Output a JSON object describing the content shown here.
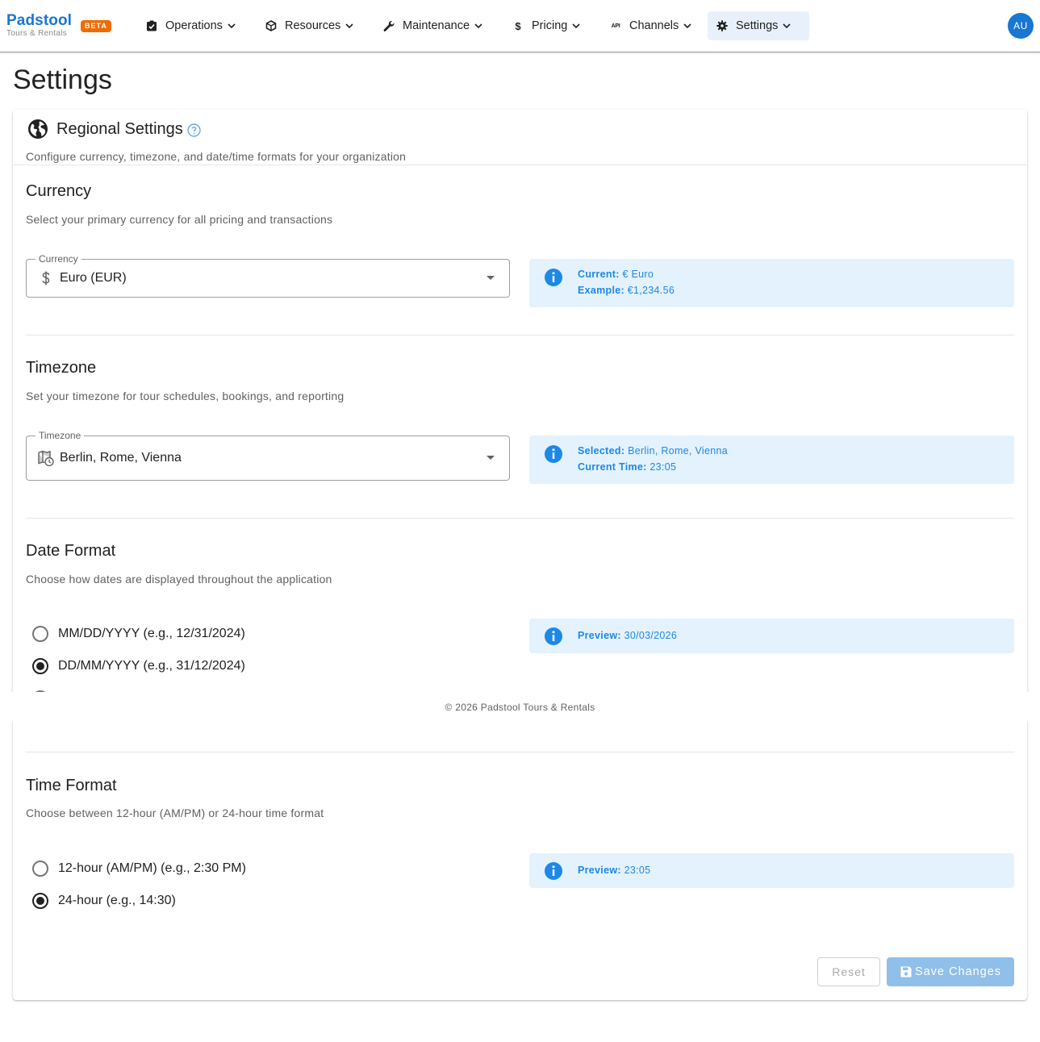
{
  "brand": {
    "name": "Padstool",
    "subtitle": "Tours & Rentals",
    "badge": "BETA"
  },
  "nav": [
    {
      "label": "Operations",
      "icon": "clipboard-icon"
    },
    {
      "label": "Resources",
      "icon": "cube-icon"
    },
    {
      "label": "Maintenance",
      "icon": "wrench-icon"
    },
    {
      "label": "Pricing",
      "icon": "dollar-icon"
    },
    {
      "label": "Channels",
      "icon": "api-icon"
    },
    {
      "label": "Settings",
      "icon": "gear-icon",
      "active": true
    }
  ],
  "user": {
    "initials": "AU"
  },
  "page": {
    "title": "Settings"
  },
  "card": {
    "title": "Regional Settings",
    "subtitle": "Configure currency, timezone, and date/time formats for your organization"
  },
  "currency": {
    "title": "Currency",
    "subtitle": "Select your primary currency for all pricing and transactions",
    "field_label": "Currency",
    "value": "Euro (EUR)",
    "info": {
      "current_label": "Current:",
      "current_value": "€ Euro",
      "example_label": "Example:",
      "example_value": "€1,234.56"
    }
  },
  "timezone": {
    "title": "Timezone",
    "subtitle": "Set your timezone for tour schedules, bookings, and reporting",
    "field_label": "Timezone",
    "value": "Berlin, Rome, Vienna",
    "info": {
      "selected_label": "Selected:",
      "selected_value": "Berlin, Rome, Vienna",
      "time_label": "Current Time:",
      "time_value": "23:05"
    }
  },
  "date_format": {
    "title": "Date Format",
    "subtitle": "Choose how dates are displayed throughout the application",
    "options": [
      {
        "label": "MM/DD/YYYY (e.g., 12/31/2024)",
        "selected": false
      },
      {
        "label": "DD/MM/YYYY (e.g., 31/12/2024)",
        "selected": true
      }
    ],
    "preview_label": "Preview:",
    "preview_value": "30/03/2026"
  },
  "time_format": {
    "title": "Time Format",
    "subtitle": "Choose between 12-hour (AM/PM) or 24-hour time format",
    "options": [
      {
        "label": "12-hour (AM/PM) (e.g., 2:30 PM)",
        "selected": false
      },
      {
        "label": "24-hour (e.g., 14:30)",
        "selected": true
      }
    ],
    "preview_label": "Preview:",
    "preview_value": "23:05"
  },
  "actions": {
    "reset": "Reset",
    "save": "Save Changes"
  },
  "footer": {
    "text": "© 2026 Padstool Tours & Rentals"
  },
  "colors": {
    "primary": "#1976d2",
    "badge": "#ef6c00",
    "info_bg": "#e3f2fd",
    "info_text": "#1e88e5"
  }
}
